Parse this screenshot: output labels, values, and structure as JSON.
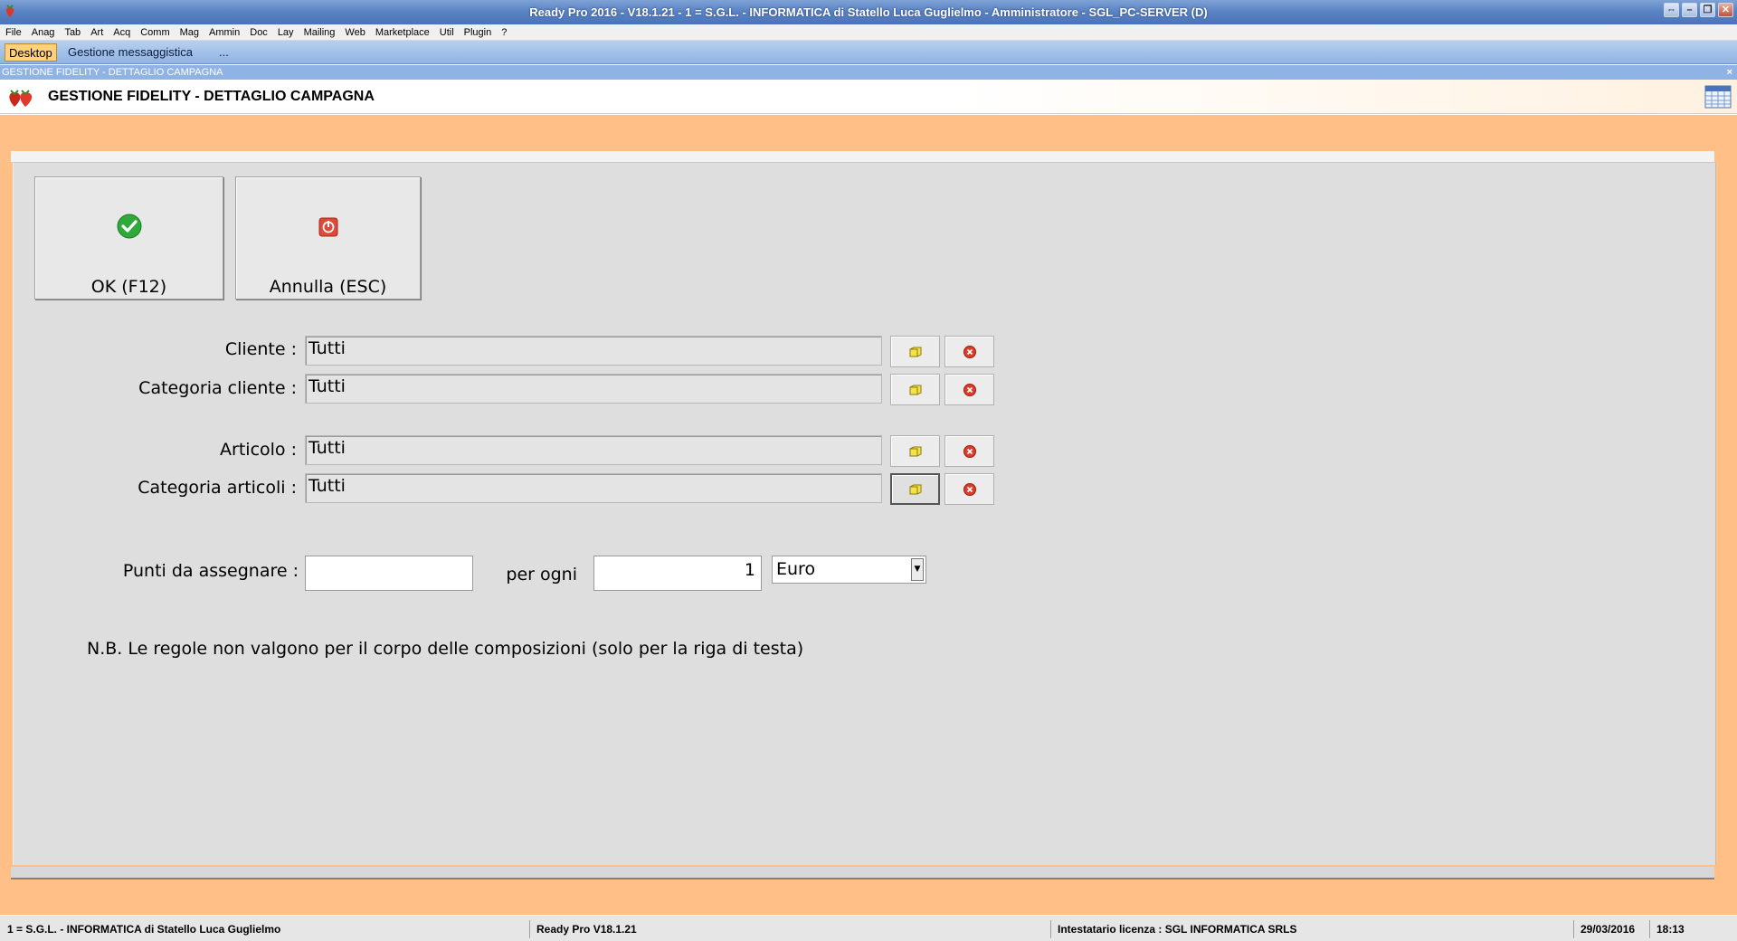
{
  "window": {
    "title": "Ready Pro 2016 - V18.1.21 - 1 = S.G.L. - INFORMATICA di Statello Luca Guglielmo - Amministratore - SGL_PC-SERVER (D)",
    "controls": [
      "⇔",
      "–",
      "❐",
      "✕"
    ]
  },
  "menu": [
    "File",
    "Anag",
    "Tab",
    "Art",
    "Acq",
    "Comm",
    "Mag",
    "Ammin",
    "Doc",
    "Lay",
    "Mailing",
    "Web",
    "Marketplace",
    "Util",
    "Plugin",
    "?"
  ],
  "tabs": {
    "desktop": "Desktop",
    "messaging": "Gestione messaggistica",
    "more": "..."
  },
  "subwindow": {
    "caption": "GESTIONE FIDELITY - DETTAGLIO CAMPAGNA",
    "close": "×"
  },
  "header": {
    "title": "GESTIONE FIDELITY - DETTAGLIO CAMPAGNA"
  },
  "buttons": {
    "ok": "OK (F12)",
    "cancel": "Annulla (ESC)"
  },
  "form": {
    "cliente": {
      "label": "Cliente :",
      "value": "Tutti"
    },
    "categoria_cliente": {
      "label": "Categoria cliente :",
      "value": "Tutti"
    },
    "articolo": {
      "label": "Articolo :",
      "value": "Tutti"
    },
    "categoria_articoli": {
      "label": "Categoria articoli :",
      "value": "Tutti"
    },
    "punti": {
      "label": "Punti da assegnare :",
      "value": ""
    },
    "per_ogni": {
      "label": "per ogni",
      "value": "1"
    },
    "currency": {
      "selected": "Euro"
    }
  },
  "note": "N.B. Le regole non valgono per il corpo delle composizioni (solo per la riga di testa)",
  "status": {
    "company": "1 = S.G.L. - INFORMATICA di Statello Luca Guglielmo",
    "version": "Ready Pro V18.1.21",
    "license": "Intestatario licenza : SGL INFORMATICA SRLS",
    "date": "29/03/2016",
    "time": "18:13"
  },
  "colors": {
    "background": "#ffbf86",
    "titlebar": "#5b84c4",
    "panel": "#dedede"
  },
  "icons": {
    "ok": "green-check-icon",
    "cancel": "red-power-icon",
    "browse": "folder-icon",
    "clear": "red-x-icon"
  }
}
